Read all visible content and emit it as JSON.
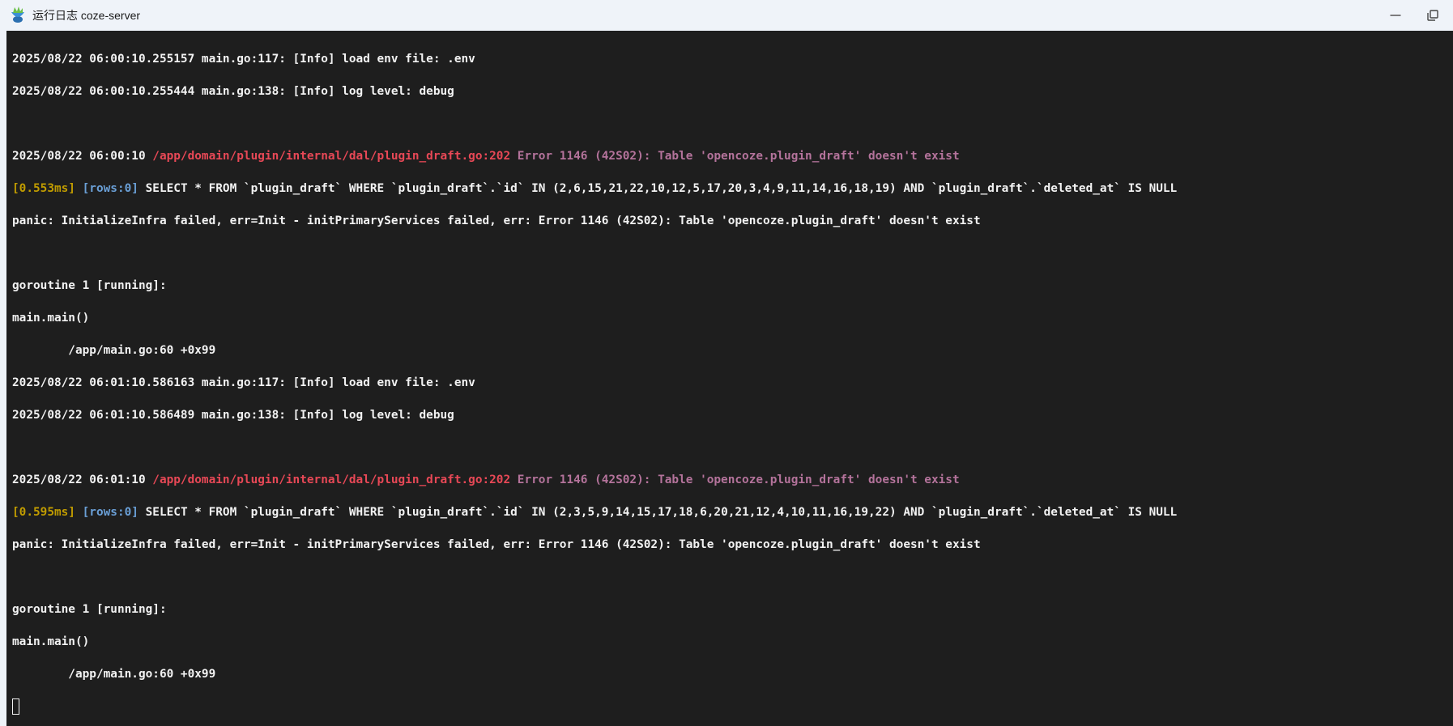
{
  "window": {
    "title": "运行日志 coze-server",
    "minimize_icon": "minimize-icon",
    "restore_icon": "restore-icon"
  },
  "log": [
    {
      "text": "2025/08/22 06:00:10.255157 main.go:117: [Info] load env file: .env"
    },
    {
      "text": "2025/08/22 06:00:10.255444 main.go:138: [Info] log level: debug"
    },
    {
      "text": ""
    },
    {
      "ts": "2025/08/22 06:00:10 ",
      "path": "/app/domain/plugin/internal/dal/plugin_draft.go:202",
      "err": " Error 1146 (42S02): Table 'opencoze.plugin_draft' doesn't exist"
    },
    {
      "dur": "[0.553ms]",
      "rows": " [rows:0]",
      "sql": " SELECT * FROM `plugin_draft` WHERE `plugin_draft`.`id` IN (2,6,15,21,22,10,12,5,17,20,3,4,9,11,14,16,18,19) AND `plugin_draft`.`deleted_at` IS NULL"
    },
    {
      "text": "panic: InitializeInfra failed, err=Init - initPrimaryServices failed, err: Error 1146 (42S02): Table 'opencoze.plugin_draft' doesn't exist"
    },
    {
      "text": ""
    },
    {
      "text": "goroutine 1 [running]:"
    },
    {
      "text": "main.main()"
    },
    {
      "text": "        /app/main.go:60 +0x99"
    },
    {
      "text": "2025/08/22 06:01:10.586163 main.go:117: [Info] load env file: .env"
    },
    {
      "text": "2025/08/22 06:01:10.586489 main.go:138: [Info] log level: debug"
    },
    {
      "text": ""
    },
    {
      "ts": "2025/08/22 06:01:10 ",
      "path": "/app/domain/plugin/internal/dal/plugin_draft.go:202",
      "err": " Error 1146 (42S02): Table 'opencoze.plugin_draft' doesn't exist"
    },
    {
      "dur": "[0.595ms]",
      "rows": " [rows:0]",
      "sql": " SELECT * FROM `plugin_draft` WHERE `plugin_draft`.`id` IN (2,3,5,9,14,15,17,18,6,20,21,12,4,10,11,16,19,22) AND `plugin_draft`.`deleted_at` IS NULL"
    },
    {
      "text": "panic: InitializeInfra failed, err=Init - initPrimaryServices failed, err: Error 1146 (42S02): Table 'opencoze.plugin_draft' doesn't exist"
    },
    {
      "text": ""
    },
    {
      "text": "goroutine 1 [running]:"
    },
    {
      "text": "main.main()"
    },
    {
      "text": "        /app/main.go:60 +0x99"
    }
  ],
  "colors": {
    "duration": "#c19c00",
    "rows": "#6a9fd6",
    "path": "#e74856",
    "error": "#b4739b",
    "background": "#1e1e1e"
  }
}
